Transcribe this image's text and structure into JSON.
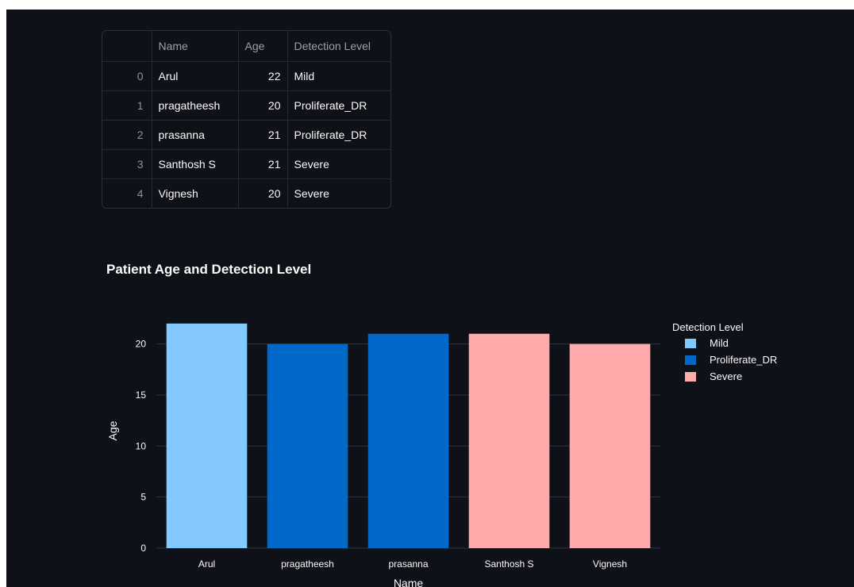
{
  "table": {
    "columns": [
      "",
      "Name",
      "Age",
      "Detection Level"
    ],
    "rows": [
      {
        "index": "0",
        "name": "Arul",
        "age": "22",
        "level": "Mild"
      },
      {
        "index": "1",
        "name": "pragatheesh",
        "age": "20",
        "level": "Proliferate_DR"
      },
      {
        "index": "2",
        "name": "prasanna",
        "age": "21",
        "level": "Proliferate_DR"
      },
      {
        "index": "3",
        "name": "Santhosh S",
        "age": "21",
        "level": "Severe"
      },
      {
        "index": "4",
        "name": "Vignesh",
        "age": "20",
        "level": "Severe"
      }
    ]
  },
  "chart_data": {
    "type": "bar",
    "title": "Patient Age and Detection Level",
    "xlabel": "Name",
    "ylabel": "Age",
    "categories": [
      "Arul",
      "pragatheesh",
      "prasanna",
      "Santhosh S",
      "Vignesh"
    ],
    "values": [
      22,
      20,
      21,
      21,
      20
    ],
    "category_group": [
      "Mild",
      "Proliferate_DR",
      "Proliferate_DR",
      "Severe",
      "Severe"
    ],
    "ylim": [
      0,
      23
    ],
    "yticks": [
      0,
      5,
      10,
      15,
      20
    ],
    "grid": true,
    "legend": {
      "title": "Detection Level",
      "placement": "right",
      "entries": [
        {
          "name": "Mild",
          "color": "#83c9ff"
        },
        {
          "name": "Proliferate_DR",
          "color": "#0068c9"
        },
        {
          "name": "Severe",
          "color": "#ffabab"
        }
      ]
    }
  },
  "colors": {
    "background": "#0e1117",
    "text": "#fafafa",
    "gridline": "#31333f"
  }
}
